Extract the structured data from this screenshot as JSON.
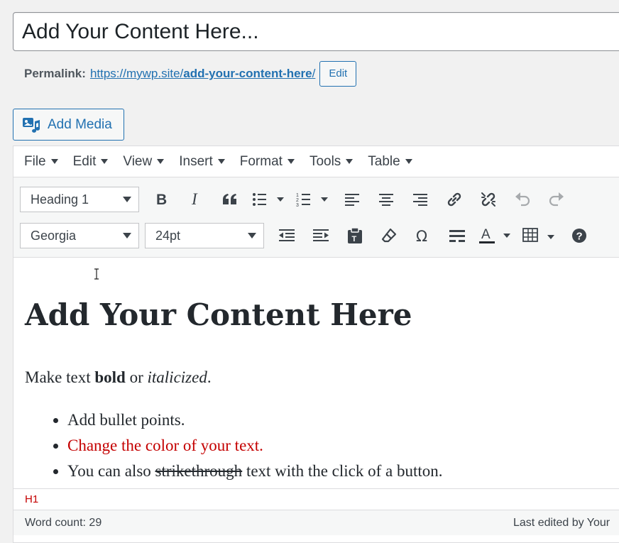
{
  "title": {
    "value": "Add Your Content Here..."
  },
  "permalink": {
    "label": "Permalink:",
    "url_base": "https://mywp.site/",
    "url_slug": "add-your-content-here",
    "url_trailing": "/",
    "edit_label": "Edit"
  },
  "add_media": {
    "label": "Add Media"
  },
  "menubar": {
    "items": [
      {
        "label": "File"
      },
      {
        "label": "Edit"
      },
      {
        "label": "View"
      },
      {
        "label": "Insert"
      },
      {
        "label": "Format"
      },
      {
        "label": "Tools"
      },
      {
        "label": "Table"
      }
    ]
  },
  "toolbar": {
    "block_format": "Heading 1",
    "font_family": "Georgia",
    "font_size": "24pt",
    "text_color": "#23282d"
  },
  "content": {
    "heading": "Add Your Content Here",
    "paragraph": {
      "pre": "Make text ",
      "bold": "bold",
      "mid": " or ",
      "italic": "italicized",
      "post": "."
    },
    "bullets": {
      "item1": "Add bullet points.",
      "item2": "Change the color of your text.",
      "item3_pre": "You can also ",
      "item3_strike": "strikethrough",
      "item3_post": " text with the click of a button."
    },
    "accent_red": "#c40000"
  },
  "statusbar": {
    "path": "H1"
  },
  "footer": {
    "word_count": "Word count: 29",
    "last_edited": "Last edited by Your"
  },
  "colors": {
    "link_blue": "#2271b1",
    "background": "#f1f1f1"
  }
}
